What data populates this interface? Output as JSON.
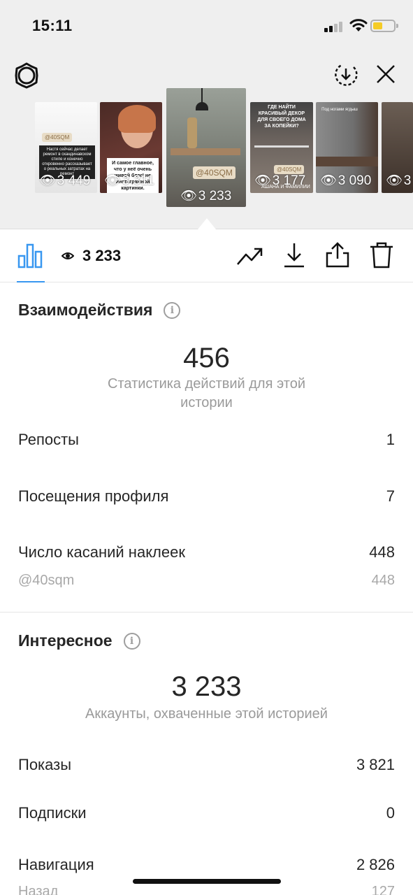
{
  "status_bar": {
    "time": "15:11"
  },
  "stories": [
    {
      "views": "3 449",
      "badge": "@40SQM",
      "caption": "Настя сейчас делает ремонт в скандинавском стиле и конечно откровенно рассказывает о реальных затратах на ремонт"
    },
    {
      "views": "3 311",
      "caption": "И самое главное, что у неё очень живой блог! не инстаграмной картинки."
    },
    {
      "views": "3 233",
      "badge": "@40SQM",
      "selected": true
    },
    {
      "views": "3 177",
      "caption": "ГДЕ НАЙТИ КРАСИВЫЙ ДЕКОР ДЛЯ СВОЕГО ДОМА ЗА КОПЕЙКИ?",
      "badge": "@40SQM",
      "footer": "АШАНА И ФАМИЛИИ"
    },
    {
      "views": "3 090",
      "caption": "Под ногами ягдыш"
    },
    {
      "views": "3"
    }
  ],
  "toolbar": {
    "views": "3 233"
  },
  "interactions": {
    "title": "Взаимодействия",
    "total": "456",
    "subtitle": "Статистика действий для этой истории",
    "rows": [
      {
        "label": "Репосты",
        "value": "1"
      },
      {
        "label": "Посещения профиля",
        "value": "7"
      },
      {
        "label": "Число касаний наклеек",
        "value": "448"
      }
    ],
    "sticker": {
      "label": "@40sqm",
      "value": "448"
    }
  },
  "discovery": {
    "title": "Интересное",
    "total": "3 233",
    "subtitle": "Аккаунты, охваченные этой историей",
    "rows": [
      {
        "label": "Показы",
        "value": "3 821"
      },
      {
        "label": "Подписки",
        "value": "0"
      },
      {
        "label": "Навигация",
        "value": "2 826"
      }
    ],
    "partial": {
      "label": "Назад",
      "value": "127"
    }
  },
  "colors": {
    "accent": "#3897f0",
    "muted": "#9a9a9a"
  }
}
